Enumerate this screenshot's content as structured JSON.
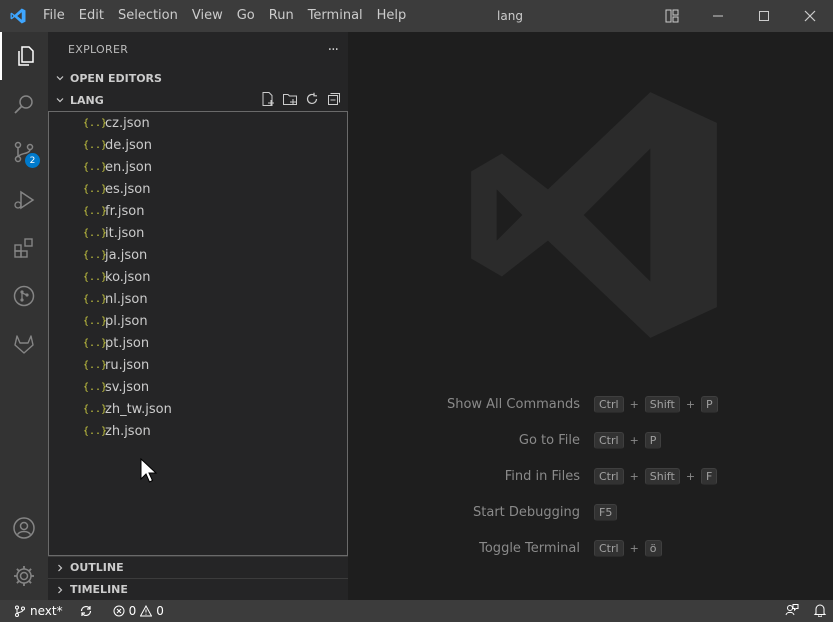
{
  "titlebar": {
    "menu": [
      "File",
      "Edit",
      "Selection",
      "View",
      "Go",
      "Run",
      "Terminal",
      "Help"
    ],
    "title": "lang"
  },
  "activitybar": {
    "scm_badge": "2"
  },
  "sidebar": {
    "title": "EXPLORER",
    "more_label": "···",
    "open_editors_label": "OPEN EDITORS",
    "folder_label": "LANG",
    "file_icon_glyph": "{..}",
    "files": [
      "cz.json",
      "de.json",
      "en.json",
      "es.json",
      "fr.json",
      "it.json",
      "ja.json",
      "ko.json",
      "nl.json",
      "pl.json",
      "pt.json",
      "ru.json",
      "sv.json",
      "zh_tw.json",
      "zh.json"
    ],
    "outline_label": "OUTLINE",
    "timeline_label": "TIMELINE"
  },
  "editor": {
    "shortcuts": [
      {
        "label": "Show All Commands",
        "keys": [
          "Ctrl",
          "Shift",
          "P"
        ]
      },
      {
        "label": "Go to File",
        "keys": [
          "Ctrl",
          "P"
        ]
      },
      {
        "label": "Find in Files",
        "keys": [
          "Ctrl",
          "Shift",
          "F"
        ]
      },
      {
        "label": "Start Debugging",
        "keys": [
          "F5"
        ]
      },
      {
        "label": "Toggle Terminal",
        "keys": [
          "Ctrl",
          "ö"
        ]
      }
    ]
  },
  "statusbar": {
    "branch": "next*",
    "errors": "0",
    "warnings": "0"
  },
  "colors": {
    "accent": "#007acc",
    "file_icon": "#cbcb41"
  }
}
